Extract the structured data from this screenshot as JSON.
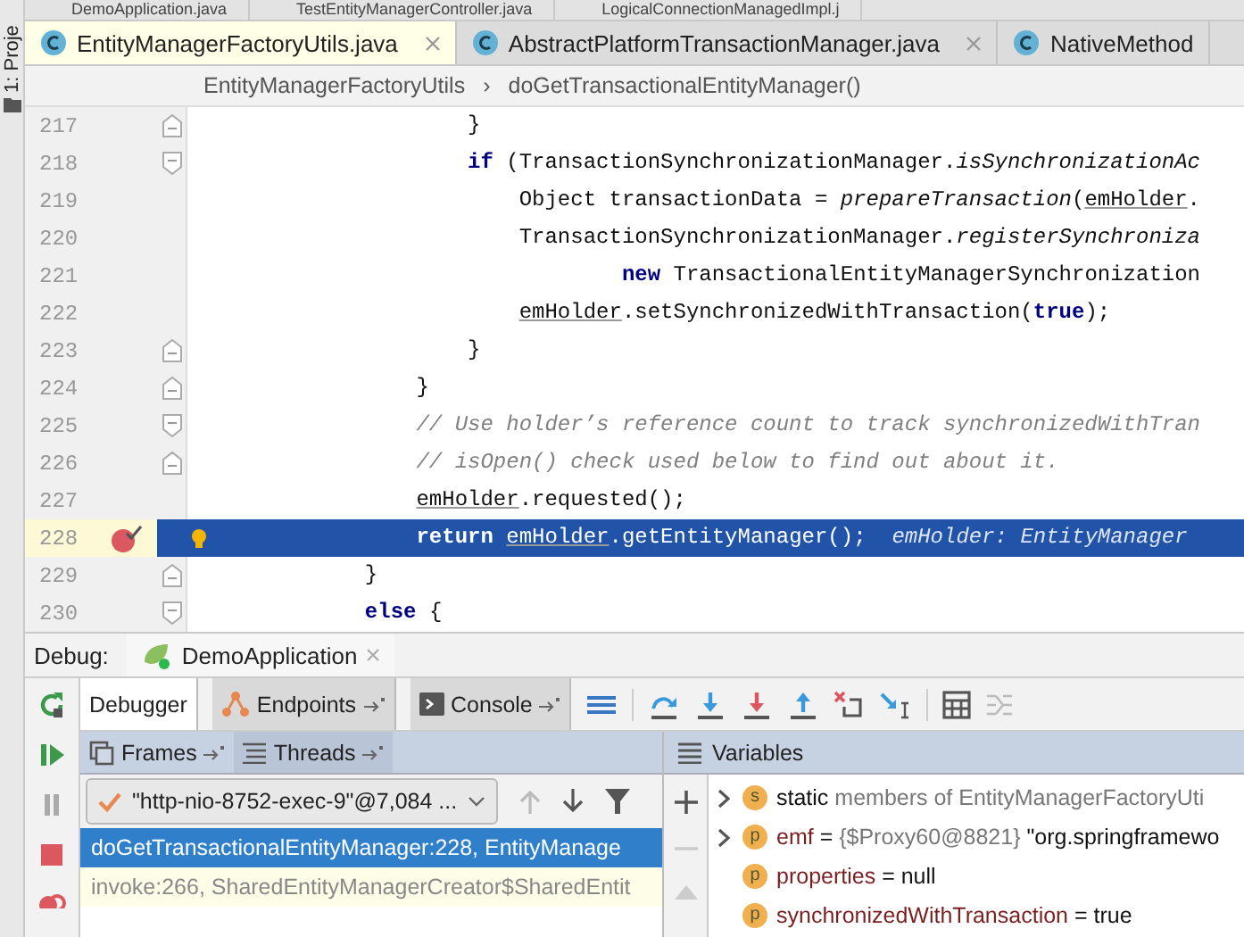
{
  "side_strip": {
    "label": "1: Proje"
  },
  "background_tabs": [
    {
      "label": "DemoApplication.java"
    },
    {
      "label": "TestEntityManagerController.java"
    },
    {
      "label": "LogicalConnectionManagedImpl.j"
    }
  ],
  "editor_tabs": [
    {
      "label": "EntityManagerFactoryUtils.java",
      "selected": true,
      "closable": true
    },
    {
      "label": "AbstractPlatformTransactionManager.java",
      "selected": false,
      "closable": true
    },
    {
      "label": "NativeMethod",
      "selected": false,
      "closable": false
    }
  ],
  "breadcrumb": {
    "items": [
      "EntityManagerFactoryUtils",
      "doGetTransactionalEntityManager()"
    ],
    "separator": "›"
  },
  "code_lines": [
    {
      "number": "217",
      "fold": {
        "kind": "end"
      },
      "current": false,
      "breakpoint": false,
      "tokens": [
        {
          "text": "                    }",
          "kind": "plain"
        }
      ]
    },
    {
      "number": "218",
      "fold": {
        "kind": "start"
      },
      "current": false,
      "breakpoint": false,
      "tokens": [
        {
          "text": "                    if",
          "kind": "keyword"
        },
        {
          "text": " (TransactionSynchronizationManager.",
          "kind": "plain"
        },
        {
          "text": "isSynchronizationAc",
          "kind": "static"
        }
      ]
    },
    {
      "number": "219",
      "current": false,
      "breakpoint": false,
      "tokens": [
        {
          "text": "                        Object transactionData = ",
          "kind": "plain"
        },
        {
          "text": "prepareTransaction",
          "kind": "static"
        },
        {
          "text": "(",
          "kind": "plain"
        },
        {
          "text": "emHolder",
          "kind": "var"
        },
        {
          "text": ".",
          "kind": "plain"
        }
      ]
    },
    {
      "number": "220",
      "current": false,
      "breakpoint": false,
      "tokens": [
        {
          "text": "                        TransactionSynchronizationManager.",
          "kind": "plain"
        },
        {
          "text": "registerSynchroniza",
          "kind": "static"
        }
      ]
    },
    {
      "number": "221",
      "current": false,
      "breakpoint": false,
      "tokens": [
        {
          "text": "                                new",
          "kind": "keyword"
        },
        {
          "text": " TransactionalEntityManagerSynchronization",
          "kind": "plain"
        }
      ]
    },
    {
      "number": "222",
      "current": false,
      "breakpoint": false,
      "tokens": [
        {
          "text": "                        emHolder",
          "kind": "var"
        },
        {
          "text": ".setSynchronizedWithTransaction(",
          "kind": "plain"
        },
        {
          "text": "true",
          "kind": "keyword"
        },
        {
          "text": ");",
          "kind": "plain"
        }
      ]
    },
    {
      "number": "223",
      "fold": {
        "kind": "end"
      },
      "current": false,
      "breakpoint": false,
      "tokens": [
        {
          "text": "                    }",
          "kind": "plain"
        }
      ]
    },
    {
      "number": "224",
      "fold": {
        "kind": "end"
      },
      "current": false,
      "breakpoint": false,
      "tokens": [
        {
          "text": "                }",
          "kind": "plain"
        }
      ]
    },
    {
      "number": "225",
      "fold": {
        "kind": "start"
      },
      "current": false,
      "breakpoint": false,
      "tokens": [
        {
          "text": "                // Use holder’s reference count to track synchronizedWithTran",
          "kind": "comment"
        }
      ]
    },
    {
      "number": "226",
      "fold": {
        "kind": "end"
      },
      "current": false,
      "breakpoint": false,
      "tokens": [
        {
          "text": "                // isOpen() check used below to find out about it.",
          "kind": "comment"
        }
      ]
    },
    {
      "number": "227",
      "current": false,
      "breakpoint": false,
      "tokens": [
        {
          "text": "                emHolder",
          "kind": "var"
        },
        {
          "text": ".requested();",
          "kind": "plain"
        }
      ]
    },
    {
      "number": "228",
      "current": true,
      "breakpoint": true,
      "tokens": [
        {
          "text": "                return ",
          "kind": "keyword"
        },
        {
          "text": "emHolder",
          "kind": "var"
        },
        {
          "text": ".getEntityManager();",
          "kind": "plain"
        },
        {
          "text": "  emHolder: EntityManager",
          "kind": "hint"
        }
      ]
    },
    {
      "number": "229",
      "fold": {
        "kind": "end"
      },
      "current": false,
      "breakpoint": false,
      "tokens": [
        {
          "text": "            }",
          "kind": "plain"
        }
      ]
    },
    {
      "number": "230",
      "fold": {
        "kind": "start"
      },
      "current": false,
      "breakpoint": false,
      "tokens": [
        {
          "text": "            else",
          "kind": "keyword"
        },
        {
          "text": " {",
          "kind": "plain"
        }
      ]
    }
  ],
  "debug": {
    "label": "Debug:",
    "session_tab": {
      "label": "DemoApplication"
    },
    "tabs": [
      {
        "label": "Debugger",
        "selected": true,
        "pinnable": false
      },
      {
        "label": "Endpoints",
        "selected": false,
        "pinnable": true
      },
      {
        "label": "Console",
        "selected": false,
        "pinnable": true
      }
    ],
    "frames_tabs": [
      {
        "label": "Frames",
        "selected": true
      },
      {
        "label": "Threads",
        "selected": false
      }
    ],
    "thread": {
      "value": "\"http-nio-8752-exec-9\"@7,084 ..."
    },
    "frames": [
      {
        "label": "doGetTransactionalEntityManager:228, EntityManage",
        "selected": true
      },
      {
        "label": "invoke:266, SharedEntityManagerCreator$SharedEntit",
        "selected": false
      }
    ],
    "variables_title": "Variables",
    "variables": [
      {
        "expandable": true,
        "badge": "s",
        "tokens": [
          {
            "text": "static",
            "kind": "name"
          },
          {
            "text": " members of EntityManagerFactoryUti",
            "kind": "ref"
          }
        ]
      },
      {
        "expandable": true,
        "badge": "p",
        "tokens": [
          {
            "text": "emf",
            "kind": "field"
          },
          {
            "text": " = ",
            "kind": "name"
          },
          {
            "text": "{$Proxy60@8821}",
            "kind": "ref"
          },
          {
            "text": " \"org.springframewo",
            "kind": "name"
          }
        ]
      },
      {
        "expandable": false,
        "badge": "p",
        "tokens": [
          {
            "text": "properties",
            "kind": "field"
          },
          {
            "text": " = null",
            "kind": "name"
          }
        ]
      },
      {
        "expandable": false,
        "badge": "p",
        "tokens": [
          {
            "text": "synchronizedWithTransaction",
            "kind": "field"
          },
          {
            "text": " = true",
            "kind": "name"
          }
        ]
      }
    ]
  }
}
